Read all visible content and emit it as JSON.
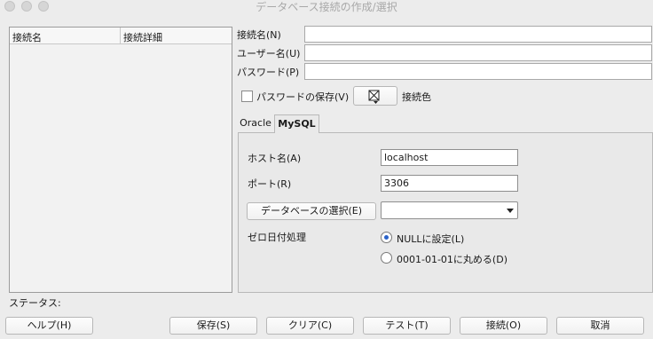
{
  "window": {
    "title": "データベース接続の作成/選択"
  },
  "conn_list": {
    "col1": "接続名",
    "col2": "接続詳細"
  },
  "form": {
    "conn_name_label": "接続名(N)",
    "conn_name_value": "",
    "user_label": "ユーザー名(U)",
    "user_value": "",
    "password_label": "パスワード(P)",
    "password_value": "",
    "save_password_label": "パスワードの保存(V)",
    "conn_color_label": "接続色"
  },
  "tabs": {
    "oracle": "Oracle",
    "mysql": "MySQL"
  },
  "mysql": {
    "host_label": "ホスト名(A)",
    "host_value": "localhost",
    "port_label": "ポート(R)",
    "port_value": "3306",
    "select_db_button": "データベースの選択(E)",
    "db_value": "",
    "zero_date_label": "ゼロ日付処理",
    "radio_null": "NULLに設定(L)",
    "radio_round": "0001-01-01に丸める(D)"
  },
  "status_label": "ステータス:",
  "buttons": {
    "help": "ヘルプ(H)",
    "save": "保存(S)",
    "clear": "クリア(C)",
    "test": "テスト(T)",
    "connect": "接続(O)",
    "cancel": "取消"
  },
  "colors": {
    "radio_selected": "#2a62c9",
    "background": "#ececec"
  },
  "icons": {
    "color_picker": "color-swatch-icon",
    "dropdown": "chevron-down-icon"
  }
}
